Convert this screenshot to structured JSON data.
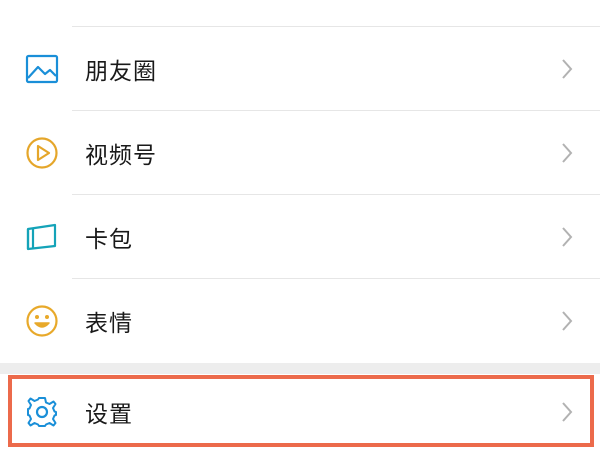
{
  "menu": {
    "items": [
      {
        "label": "朋友圈",
        "icon": "moments-image-icon",
        "color": "#1a8fd8"
      },
      {
        "label": "视频号",
        "icon": "channels-play-icon",
        "color": "#e5a62a"
      },
      {
        "label": "卡包",
        "icon": "card-wallet-icon",
        "color": "#14a3b8"
      },
      {
        "label": "表情",
        "icon": "smiley-face-icon",
        "color": "#e8a92a"
      }
    ],
    "settings": {
      "label": "设置",
      "icon": "gear-icon",
      "color": "#1a8fd8"
    }
  },
  "highlight_color": "#ec6a4b"
}
